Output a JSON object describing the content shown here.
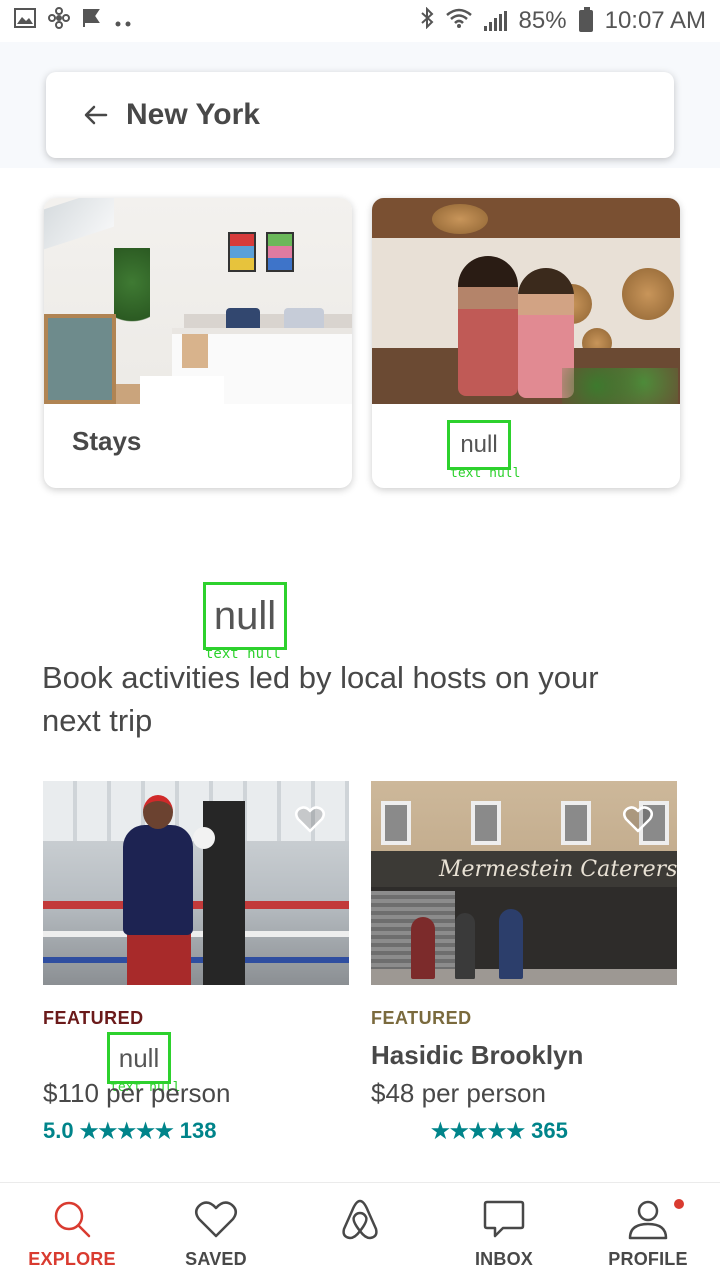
{
  "status_bar": {
    "battery": "85%",
    "time": "10:07 AM",
    "left_icons": [
      "image-icon",
      "fan-icon",
      "check-flag-icon",
      "more-dots-icon"
    ],
    "right_icons": [
      "bluetooth-icon",
      "wifi-icon",
      "signal-icon",
      "battery-icon"
    ]
  },
  "search": {
    "title": "New York"
  },
  "categories": [
    {
      "label": "Stays"
    },
    {
      "label": "null",
      "caption": "text null"
    }
  ],
  "experiences_section": {
    "null_label": "null",
    "null_caption": "text null",
    "title": "Book activities led by local hosts on your next trip"
  },
  "experiences": [
    {
      "badge": "FEATURED",
      "badge_color": "#6b1a1a",
      "title": "null",
      "title_caption": "text null",
      "price": "$110 per person",
      "rating": "5.0",
      "stars": "★★★★★",
      "reviews": "138"
    },
    {
      "badge": "FEATURED",
      "badge_color": "#7a6a3d",
      "title": "Hasidic Brooklyn",
      "price": "$48 per person",
      "rating": "",
      "stars": "★★★★★",
      "reviews": "365",
      "storefront_sign": "Mermestein Caterers"
    }
  ],
  "bottom_nav": [
    {
      "label": "EXPLORE",
      "icon": "search-icon",
      "active": true
    },
    {
      "label": "SAVED",
      "icon": "heart-icon",
      "active": false
    },
    {
      "label": "",
      "icon": "airbnb-logo-icon",
      "active": false
    },
    {
      "label": "INBOX",
      "icon": "message-icon",
      "active": false
    },
    {
      "label": "PROFILE",
      "icon": "profile-icon",
      "active": false
    }
  ],
  "colors": {
    "accent": "#d93b30",
    "rating": "#00848a",
    "text": "#484848",
    "debug_box": "#2dd12d"
  }
}
